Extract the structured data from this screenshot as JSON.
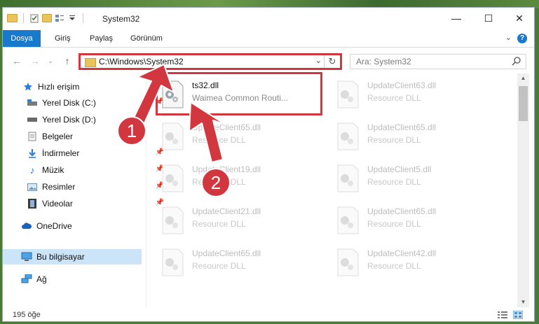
{
  "window": {
    "title": "System32"
  },
  "ribbon": {
    "tabs": [
      "Dosya",
      "Giriş",
      "Paylaş",
      "Görünüm"
    ]
  },
  "address": {
    "path": "C:\\Windows\\System32"
  },
  "search": {
    "placeholder": "Ara: System32"
  },
  "sidebar": {
    "items": [
      {
        "label": "Hızlı erişim",
        "icon": "star-icon"
      },
      {
        "label": "Yerel Disk (C:)",
        "icon": "drive-icon"
      },
      {
        "label": "Yerel Disk (D:)",
        "icon": "drive-icon"
      },
      {
        "label": "Belgeler",
        "icon": "documents-icon"
      },
      {
        "label": "İndirmeler",
        "icon": "download-icon"
      },
      {
        "label": "Müzik",
        "icon": "music-icon"
      },
      {
        "label": "Resimler",
        "icon": "pictures-icon"
      },
      {
        "label": "Videolar",
        "icon": "videos-icon"
      },
      {
        "label": "OneDrive",
        "icon": "cloud-icon"
      },
      {
        "label": "Bu bilgisayar",
        "icon": "computer-icon"
      },
      {
        "label": "Ağ",
        "icon": "network-icon"
      }
    ]
  },
  "files": [
    {
      "name": "ts32.dll",
      "desc": "Waimea Common Routi..."
    },
    {
      "name": "UpdateClient63.dll",
      "desc": "Resource DLL"
    },
    {
      "name": "UpdateClient65.dll",
      "desc": "Resource DLL"
    },
    {
      "name": "UpdateClient65.dll",
      "desc": "Resource DLL"
    },
    {
      "name": "UpdateClient19.dll",
      "desc": "Resource DLL"
    },
    {
      "name": "UpdateClient5.dll",
      "desc": "Resource DLL"
    },
    {
      "name": "UpdateClient21.dll",
      "desc": "Resource DLL"
    },
    {
      "name": "UpdateClient65.dll",
      "desc": "Resource DLL"
    },
    {
      "name": "UpdateClient65.dll",
      "desc": "Resource DLL"
    },
    {
      "name": "UpdateClient42.dll",
      "desc": "Resource DLL"
    }
  ],
  "status": {
    "count": "195 öğe"
  },
  "annotations": {
    "badge1": "1",
    "badge2": "2",
    "color": "#d2363f"
  }
}
